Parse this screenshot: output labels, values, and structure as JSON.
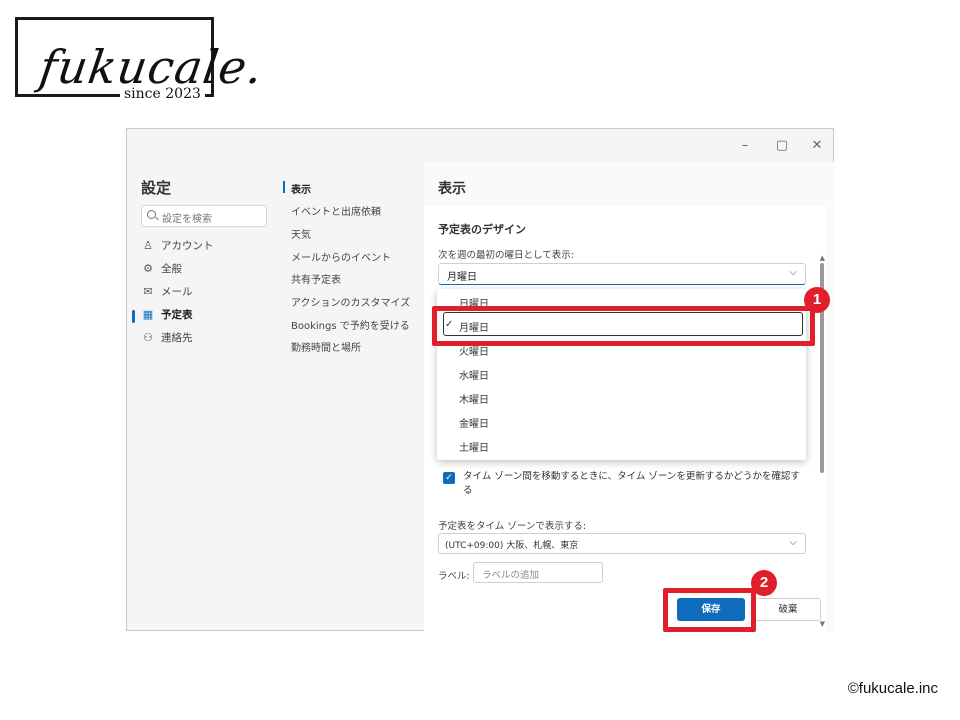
{
  "logo": {
    "text": "fukucale.",
    "since": "since 2023"
  },
  "copyright": "©fukucale.inc",
  "window": {
    "controls": {
      "minimize": "–",
      "maximize": "▢",
      "close": "✕"
    }
  },
  "settings": {
    "title": "設定",
    "search_placeholder": "設定を検索",
    "nav": [
      {
        "icon": "person-icon",
        "glyph": "♙",
        "label": "アカウント"
      },
      {
        "icon": "gear-icon",
        "glyph": "⚙",
        "label": "全般"
      },
      {
        "icon": "mail-icon",
        "glyph": "✉",
        "label": "メール"
      },
      {
        "icon": "calendar-icon",
        "glyph": "▦",
        "label": "予定表"
      },
      {
        "icon": "people-icon",
        "glyph": "⚇",
        "label": "連絡先"
      }
    ],
    "sub_nav": [
      "表示",
      "イベントと出席依頼",
      "天気",
      "メールからのイベント",
      "共有予定表",
      "アクションのカスタマイズ",
      "Bookings で予約を受ける",
      "勤務時間と場所"
    ]
  },
  "pane": {
    "title": "表示",
    "section_title": "予定表のデザイン",
    "week_start_label": "次を週の最初の曜日として表示:",
    "week_start_value": "月曜日",
    "dropdown_options": [
      "日曜日",
      "月曜日",
      "火曜日",
      "水曜日",
      "木曜日",
      "金曜日",
      "土曜日"
    ],
    "dropdown_selected": "月曜日",
    "checkbox_label": "タイム ゾーン間を移動するときに、タイム ゾーンを更新するかどうかを確認する",
    "checkbox_checked": true,
    "timezone_label": "予定表をタイム ゾーンで表示する:",
    "timezone_value": "(UTC+09:00) 大阪、札幌、東京",
    "label_label": "ラベル:",
    "label_placeholder": "ラベルの追加",
    "save": "保存",
    "discard": "破棄"
  },
  "annotations": {
    "badge1": "1",
    "badge2": "2",
    "color": "#e01f2b"
  },
  "colors": {
    "accent": "#0f6cbd"
  }
}
